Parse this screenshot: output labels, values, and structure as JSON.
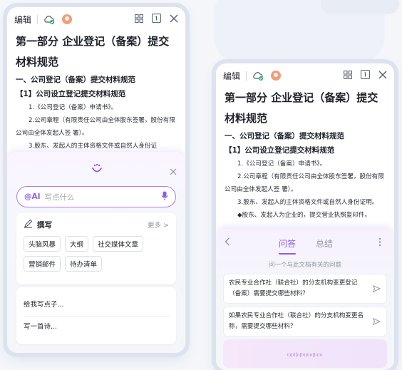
{
  "left": {
    "topbar": {
      "edit": "编辑"
    },
    "doc": {
      "title": "第一部分 企业登记（备案）提交材料规范",
      "section": "一、公司登记（备案）提交材料规范",
      "subsection": "【1】公司设立登记提交材料规范",
      "item1": "1.《公司登记（备案）申请书》。",
      "item2": "2.公司章程（有限责任公司由全体股东签署，股份有限公司由全体发起人签 署）。",
      "item3": "3.股东、发起人的主体资格文件或自然人身份证"
    },
    "ai": {
      "input_tag": "@AI",
      "input_placeholder": "写点什么",
      "write_title": "撰写",
      "more": "更多 >",
      "chips": [
        "头脑风暴",
        "大纲",
        "社交媒体文章",
        "营销邮件",
        "待办清单"
      ],
      "suggestions": [
        "给我写点子...",
        "写一首诗..."
      ]
    }
  },
  "right": {
    "topbar": {
      "edit": "编辑"
    },
    "doc": {
      "title": "第一部分 企业登记（备案）提交材料规范",
      "section": "一、公司登记（备案）提交材料规范",
      "subsection": "【1】公司设立登记提交材料规范",
      "item1": "1.《公司登记（备案）申请书》。",
      "item2": "2.公司章程（有限责任公司由全体股东签署，股份有限公司由全体发起人签 署）。",
      "item3": "3.股东、发起人的主体资格文件或自然人身份证明。",
      "item4": "◆股东、发起人为企业的，提交营业执照复印件。"
    },
    "ai": {
      "tab_qa": "问答",
      "tab_summary": "总结",
      "hint": "问一个与此文档有关的问题",
      "questions": [
        "农民专业合作社（联合社）的分支机构变更登记（备案）需要提交哪些材料？",
        "如果农民专业合作社（联合社）的分支机构变更名称，需要提交哪些材料？"
      ]
    }
  },
  "colors": {
    "accent": "#8a5cf0",
    "status_green": "#27b36a"
  }
}
